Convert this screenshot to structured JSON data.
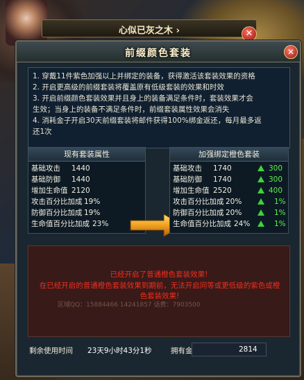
{
  "background": {
    "window_title": "心似已灰之木 ›",
    "close_label": "✕"
  },
  "panel": {
    "title": "前缀颜色套装",
    "close_label": "✕"
  },
  "description": [
    "1. 穿戴11件紫色加强以上并绑定的装备，获得激活该套装效果的资格",
    "2. 开启更高级的前缀套装将覆盖原有低级套装的效果和时效",
    "3. 开启前缀颜色套装效果并且身上的装备满足条件时，套装效果才会",
    "生效；当身上的装备不满足条件时，前缀套装属性效果会消失",
    "4. 消耗金子开启30天前缀套装将邮件获得100%绑金返还，每月最多返",
    "还1次"
  ],
  "current_set": {
    "header": "现有套装属性",
    "rows": [
      {
        "label": "基础攻击",
        "value": "1440"
      },
      {
        "label": "基础防御",
        "value": "1440"
      },
      {
        "label": "增加生命值",
        "value": "2120"
      },
      {
        "label": "攻击百分比加成",
        "value": "19%"
      },
      {
        "label": "防御百分比加成",
        "value": "19%"
      },
      {
        "label": "生命值百分比加成",
        "value": "23%"
      }
    ]
  },
  "enhanced_set": {
    "header": "加强绑定橙色套装",
    "rows": [
      {
        "label": "基础攻击",
        "value": "1740",
        "gain": "300"
      },
      {
        "label": "基础防御",
        "value": "1740",
        "gain": "300"
      },
      {
        "label": "增加生命值",
        "value": "2520",
        "gain": "400"
      },
      {
        "label": "攻击百分比加成",
        "value": "20%",
        "gain": "1%"
      },
      {
        "label": "防御百分比加成",
        "value": "20%",
        "gain": "1%"
      },
      {
        "label": "生命值百分比加成",
        "value": "24%",
        "gain": "1%"
      }
    ]
  },
  "messages": {
    "line1": "已经开启了普通橙色套装效果!",
    "line2": "在已经开启的普通橙色套装效果到期前，无法开启同等或更低级的紫色或橙色套装效果!",
    "ghost_text": "区域QQ：15884466  14241857  话费：7903500"
  },
  "footer": {
    "remaining_label": "剩余使用时间",
    "remaining_value": "23天9小时43分1秒",
    "gold_label": "拥有金子",
    "gold_value": "2814"
  },
  "colors": {
    "panel_bg": "#1b2730",
    "gain_green": "#5cf04e",
    "warning_red": "#ff2e1c",
    "arrow_orange": "#f0a020"
  }
}
